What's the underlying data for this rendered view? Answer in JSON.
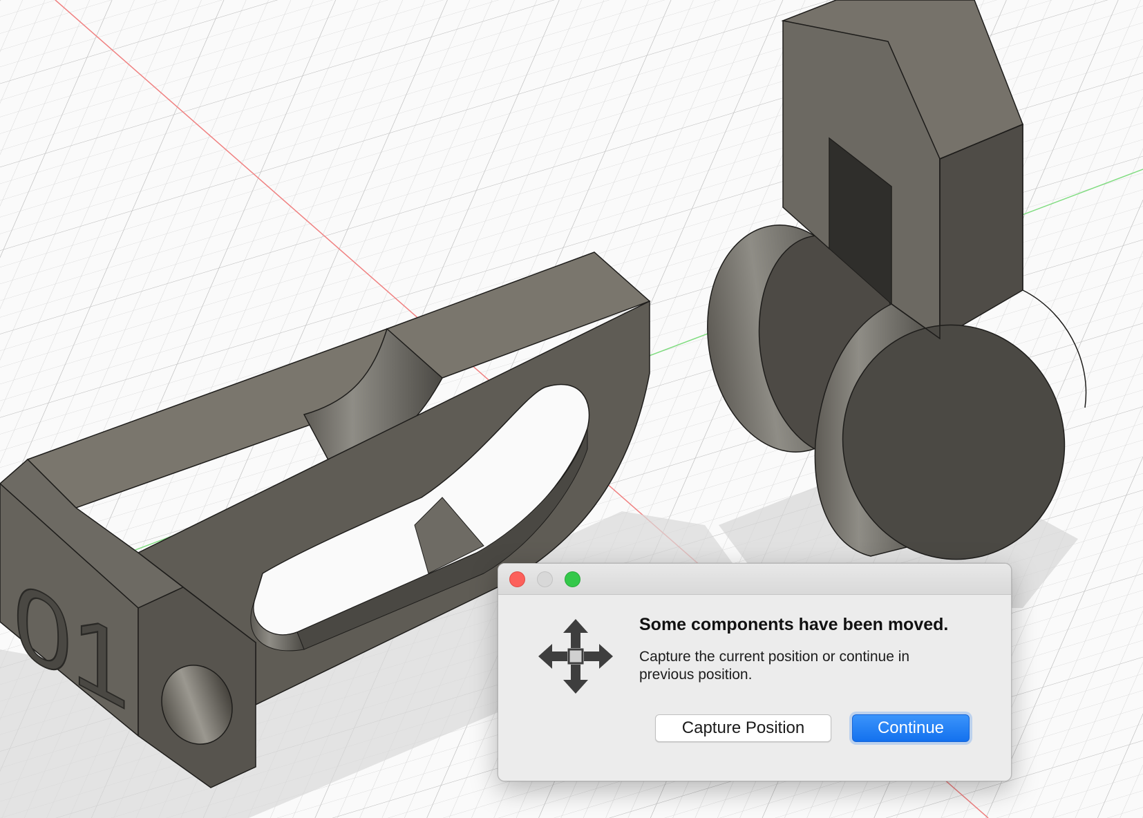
{
  "viewport": {
    "part_label": "01"
  },
  "dialog": {
    "title": "Some components have been moved.",
    "message": "Capture the current position or continue in previous position.",
    "icon": "move-arrows-icon",
    "buttons": {
      "capture_label": "Capture Position",
      "continue_label": "Continue"
    },
    "colors": {
      "primary_button": "#1a78f2",
      "close": "#fc605b",
      "zoom": "#34c84a"
    }
  }
}
